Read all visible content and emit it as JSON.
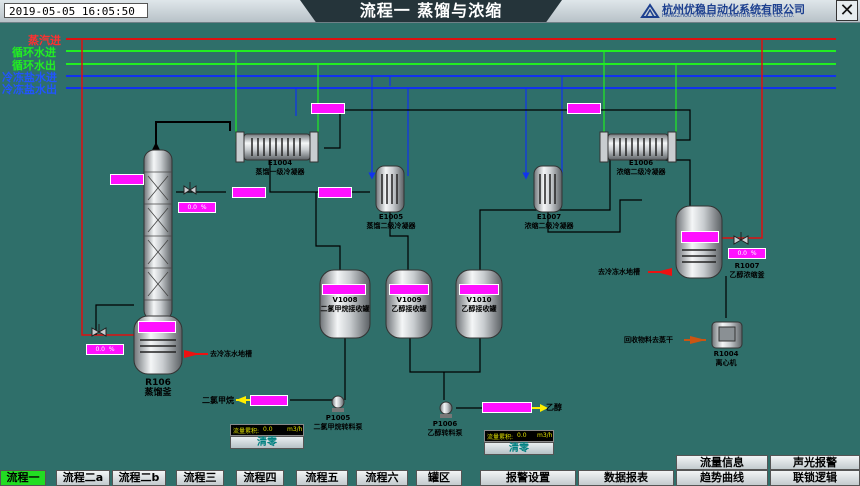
{
  "header": {
    "datetime": "2019-05-05 16:05:50",
    "title": "流程一  蒸馏与浓缩",
    "company_name": "杭州优稳自动化系统有限公司",
    "company_sub": "HANGZHOU UWNTEK AUTOMATION SYSTEM CO.,LTD.",
    "close_label": "✕"
  },
  "utilities": {
    "steam": "蒸汽进",
    "circ_in": "循环水进",
    "circ_out": "循环水出",
    "brine_in": "冷冻盐水进",
    "brine_out": "冷冻盐水出"
  },
  "equipment": {
    "e1004_id": "E1004",
    "e1004_name": "蒸馏一级冷凝器",
    "e1005_id": "E1005",
    "e1005_name": "蒸馏二级冷凝器",
    "e1006_id": "E1006",
    "e1006_name": "浓缩二级冷凝器",
    "e1007_id": "E1007",
    "e1007_name": "浓缩二级冷凝器",
    "r106_id": "R106",
    "r106_name": "蒸馏釜",
    "v1008_id": "V1008",
    "v1008_name": "二氯甲烷接收罐",
    "v1009_id": "V1009",
    "v1009_name": "乙醇接收罐",
    "v1010_id": "V1010",
    "v1010_name": "乙醇接收罐",
    "r1007_id": "R1007",
    "r1007_name": "乙醇浓缩釜",
    "r1004_id": "R1004",
    "r1004_name": "离心机",
    "p1005_id": "P1005",
    "p1005_name": "二氯甲烷转料泵",
    "p1006_id": "P1006",
    "p1006_name": "乙醇转料泵"
  },
  "valves": {
    "v_top_value": "0.0",
    "v_top_unit": "%",
    "v_bottom_value": "0.0",
    "v_bottom_unit": "%",
    "v_right_value": "0.0",
    "v_right_unit": "%"
  },
  "flow_text": {
    "to_chilled_return_left": "去冷冻水地槽",
    "to_chilled_return_right": "去冷冻水地槽",
    "recovered_material": "回收物料去蒸干",
    "dichloromethane": "二氯甲烷",
    "ethanol": "乙醇"
  },
  "flowmeters": {
    "left_label": "流量累积:",
    "left_value": "0.0",
    "left_unit": "m3/h",
    "left_clear": "清零",
    "right_label": "流量累积:",
    "right_value": "0.0",
    "right_unit": "m3/h",
    "right_clear": "清零"
  },
  "nav": {
    "tabs": [
      "流程一",
      "流程二a",
      "流程二b",
      "流程三",
      "流程四",
      "流程五",
      "流程六",
      "罐区"
    ],
    "active_index": 0,
    "alarm_settings": "报警设置",
    "data_report": "数据报表",
    "flow_info": "流量信息",
    "trend_curve": "趋势曲线",
    "sound_light_alarm": "声光报警",
    "interlock_logic": "联锁逻辑"
  },
  "colors": {
    "background": "#2f6f6a",
    "steam_line": "#dd1111",
    "circ_line": "#22ee22",
    "brine_line": "#1133ee",
    "tag_fill": "#ff10ff"
  }
}
